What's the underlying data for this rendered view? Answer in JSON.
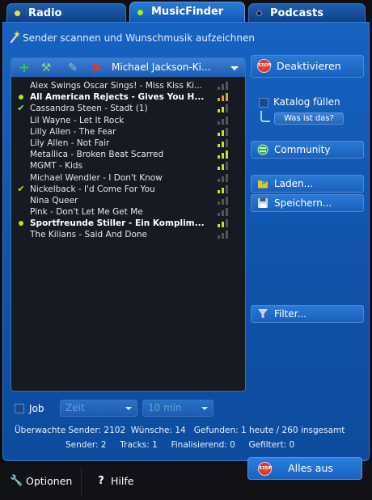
{
  "tabs": [
    {
      "label": "Radio"
    },
    {
      "label": "MusicFinder"
    },
    {
      "label": "Podcasts"
    }
  ],
  "headline": "Sender scannen und Wunschmusik aufzeichnen",
  "list": {
    "title": "Michael Jackson-Ki...",
    "rows": [
      {
        "text": "Alex Swings Oscar Sings! - Miss Kiss Ki...",
        "mark": "",
        "bold": false,
        "signal": "gray"
      },
      {
        "text": "All American Rejects - Gives You H...",
        "mark": "dot",
        "bold": true,
        "signal": "orange"
      },
      {
        "text": "Cassandra Steen - Stadt (1)",
        "mark": "check",
        "bold": false,
        "signal": "yellow"
      },
      {
        "text": "Lil Wayne - Let It Rock",
        "mark": "",
        "bold": false,
        "signal": "gray"
      },
      {
        "text": "Lilly Allen - The Fear",
        "mark": "",
        "bold": false,
        "signal": "yellow"
      },
      {
        "text": "Lily Allen - Not Fair",
        "mark": "",
        "bold": false,
        "signal": "yellow"
      },
      {
        "text": "Metallica - Broken Beat Scarred",
        "mark": "",
        "bold": false,
        "signal": "green"
      },
      {
        "text": "MGMT - Kids",
        "mark": "",
        "bold": false,
        "signal": "yellow"
      },
      {
        "text": "Michael Wendler - I Don't Know",
        "mark": "",
        "bold": false,
        "signal": "gray"
      },
      {
        "text": "Nickelback - I'd Come For You",
        "mark": "check",
        "bold": false,
        "signal": "yellow"
      },
      {
        "text": "Nina Queer",
        "mark": "",
        "bold": false,
        "signal": "gray"
      },
      {
        "text": "Pink - Don't Let Me Get Me",
        "mark": "",
        "bold": false,
        "signal": "gray"
      },
      {
        "text": "Sportfreunde Stiller - Ein Komplim...",
        "mark": "dot",
        "bold": true,
        "signal": "yellow"
      },
      {
        "text": "The Kilians - Said And Done",
        "mark": "",
        "bold": false,
        "signal": "gray"
      }
    ]
  },
  "side": {
    "deaktivieren": "Deaktivieren",
    "katalog": "Katalog füllen",
    "was_ist_das": "Was ist das?",
    "community": "Community",
    "laden": "Laden...",
    "speichern": "Speichern...",
    "filter": "Filter..."
  },
  "stop_label": "STOP",
  "job": {
    "label": "Job",
    "zeit": "Zeit",
    "minutes": "10 min"
  },
  "stats": {
    "line1": "Überwachte Sender: 2102  Wünsche: 14   Gefunden: 1 heute / 260 insgesamt",
    "line2": "Sender: 2     Tracks: 1     Finalisierend: 0     Gefiltert: 0"
  },
  "footer": {
    "optionen": "Optionen",
    "hilfe": "Hilfe",
    "alles_aus": "Alles aus"
  },
  "colors": {
    "panel": "#1762c2",
    "list_bg": "#161a22",
    "active_dot": "#9ef020",
    "stop_red": "#d0302a"
  }
}
